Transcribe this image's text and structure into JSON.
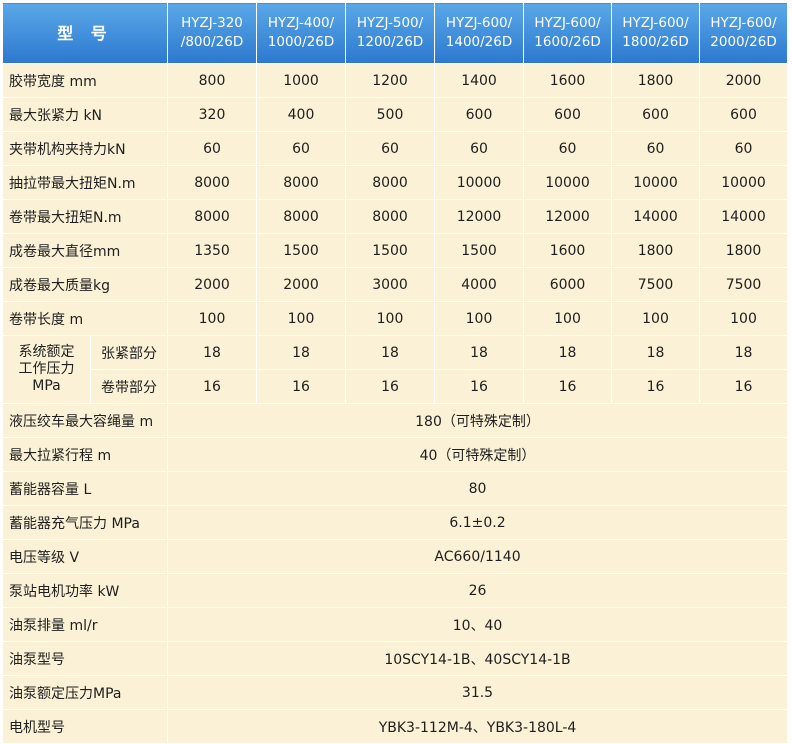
{
  "header": {
    "title": "型  号",
    "models": [
      [
        "HYZJ-320",
        "/800/26D"
      ],
      [
        "HYZJ-400/",
        "1000/26D"
      ],
      [
        "HYZJ-500/",
        "1200/26D"
      ],
      [
        "HYZJ-600/",
        "1400/26D"
      ],
      [
        "HYZJ-600/",
        "1600/26D"
      ],
      [
        "HYZJ-600/",
        "1800/26D"
      ],
      [
        "HYZJ-600/",
        "2000/26D"
      ]
    ]
  },
  "rows": [
    {
      "label": "胶带宽度 mm",
      "values": [
        "800",
        "1000",
        "1200",
        "1400",
        "1600",
        "1800",
        "2000"
      ]
    },
    {
      "label": "最大张紧力 kN",
      "values": [
        "320",
        "400",
        "500",
        "600",
        "600",
        "600",
        "600"
      ]
    },
    {
      "label": "夹带机构夹持力kN",
      "values": [
        "60",
        "60",
        "60",
        "60",
        "60",
        "60",
        "60"
      ]
    },
    {
      "label": "抽拉带最大扭矩N.m",
      "values": [
        "8000",
        "8000",
        "8000",
        "10000",
        "10000",
        "10000",
        "10000"
      ]
    },
    {
      "label": "卷带最大扭矩N.m",
      "values": [
        "8000",
        "8000",
        "8000",
        "12000",
        "12000",
        "14000",
        "14000"
      ]
    },
    {
      "label": "成卷最大直径mm",
      "values": [
        "1350",
        "1500",
        "1500",
        "1500",
        "1600",
        "1800",
        "1800"
      ]
    },
    {
      "label": "成卷最大质量kg",
      "values": [
        "2000",
        "2000",
        "3000",
        "4000",
        "6000",
        "7500",
        "7500"
      ]
    },
    {
      "label": "卷带长度 m",
      "values": [
        "100",
        "100",
        "100",
        "100",
        "100",
        "100",
        "100"
      ]
    }
  ],
  "pressure": {
    "group_label": [
      "系统额定",
      "工作压力",
      "MPa"
    ],
    "rows": [
      {
        "label": "张紧部分",
        "values": [
          "18",
          "18",
          "18",
          "18",
          "18",
          "18",
          "18"
        ]
      },
      {
        "label": "卷带部分",
        "values": [
          "16",
          "16",
          "16",
          "16",
          "16",
          "16",
          "16"
        ]
      }
    ]
  },
  "common_rows": [
    {
      "label": "液压绞车最大容绳量 m",
      "value": "180（可特殊定制）"
    },
    {
      "label": "最大拉紧行程 m",
      "value": "40（可特殊定制）"
    },
    {
      "label": "蓄能器容量 L",
      "value": "80"
    },
    {
      "label": "蓄能器充气压力 MPa",
      "value": "6.1±0.2"
    },
    {
      "label": "电压等级 V",
      "value": "AC660/1140"
    },
    {
      "label": "泵站电机功率 kW",
      "value": "26"
    },
    {
      "label": "油泵排量 ml/r",
      "value": "10、40"
    },
    {
      "label": "油泵型号",
      "value": "10SCY14-1B、40SCY14-1B"
    },
    {
      "label": "油泵额定压力MPa",
      "value": "31.5"
    },
    {
      "label": "电机型号",
      "value": "YBK3-112M-4、YBK3-180L-4"
    }
  ],
  "colors": {
    "header_bg": "#2c78cf",
    "cell_bg": "#fbf1d6",
    "grid": "#ffffff"
  }
}
